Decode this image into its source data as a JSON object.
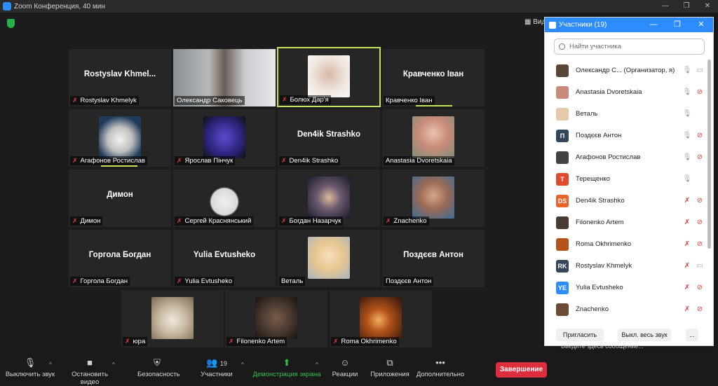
{
  "window": {
    "title": "Zoom Конференция, 40 мин",
    "minimize": "—",
    "restore": "❐",
    "close": "✕"
  },
  "view_button": "Вид",
  "tiles": [
    {
      "big": "Rostyslav  Khmel...",
      "label": "Rostyslav Khmelyk"
    },
    {
      "big": "",
      "label": "Олександр Саковець"
    },
    {
      "big": "",
      "label": "Болюх Дар'я"
    },
    {
      "big": "Кравченко Іван",
      "label": "Кравченко Іван"
    },
    {
      "big": "",
      "label": "Агафонов Ростислав"
    },
    {
      "big": "",
      "label": "Ярослав Пінчук"
    },
    {
      "big": "Den4ik Strashko",
      "label": "Den4ik Strashko"
    },
    {
      "big": "",
      "label": "Anastasia Dvoretskaia"
    },
    {
      "big": "Димон",
      "label": "Димон"
    },
    {
      "big": "",
      "label": "Сергей Краснянський"
    },
    {
      "big": "",
      "label": "Богдан Назарчук"
    },
    {
      "big": "",
      "label": "Znachenko"
    },
    {
      "big": "Горгола Богдан",
      "label": "Горгола Богдан"
    },
    {
      "big": "Yulia Evtusheko",
      "label": "Yulia Evtusheko"
    },
    {
      "big": "",
      "label": "Веталь"
    },
    {
      "big": "Поздєєв Антон",
      "label": "Поздєєв Антон"
    },
    {
      "big": "",
      "label": "юра"
    },
    {
      "big": "",
      "label": "Filonenko Artem"
    },
    {
      "big": "",
      "label": "Roma Okhrimenko"
    }
  ],
  "toolbar": {
    "mute": "Выключить звук",
    "video": "Остановить видео",
    "security": "Безопасность",
    "participants": "Участники",
    "participants_count": "19",
    "share": "Демонстрация экрана",
    "reactions": "Реакции",
    "apps": "Приложения",
    "more": "Дополнительно",
    "end": "Завершение"
  },
  "panel": {
    "title": "Участники (19)",
    "search_placeholder": "Найти участника",
    "invite": "Пригласить",
    "mute_all": "Выкл. весь звук",
    "more": "...",
    "participants": [
      {
        "name": "Олександр С... (Организатор, я)",
        "initials": "",
        "color": "#5a4636"
      },
      {
        "name": "Anastasia Dvoretskaia",
        "initials": "",
        "color": "#c98a7a"
      },
      {
        "name": "Веталь",
        "initials": "",
        "color": "#e6c9a8"
      },
      {
        "name": "Поздєєв Антон",
        "initials": "П",
        "color": "#33475b"
      },
      {
        "name": "Агафонов Ростислав",
        "initials": "",
        "color": "#444"
      },
      {
        "name": "Терещенко",
        "initials": "Т",
        "color": "#e04b2f"
      },
      {
        "name": "Den4ik Strashko",
        "initials": "DS",
        "color": "#e8642a"
      },
      {
        "name": "Filonenko Artem",
        "initials": "",
        "color": "#4a3a30"
      },
      {
        "name": "Roma Okhrimenko",
        "initials": "",
        "color": "#b4531a"
      },
      {
        "name": "Rostyslav Khmelyk",
        "initials": "RK",
        "color": "#33475b"
      },
      {
        "name": "Yulia Evtusheko",
        "initials": "YE",
        "color": "#2d8cff"
      },
      {
        "name": "Znachenko",
        "initials": "",
        "color": "#6b4a38"
      }
    ]
  },
  "chat_hint": "Введите здесь сообщение..."
}
